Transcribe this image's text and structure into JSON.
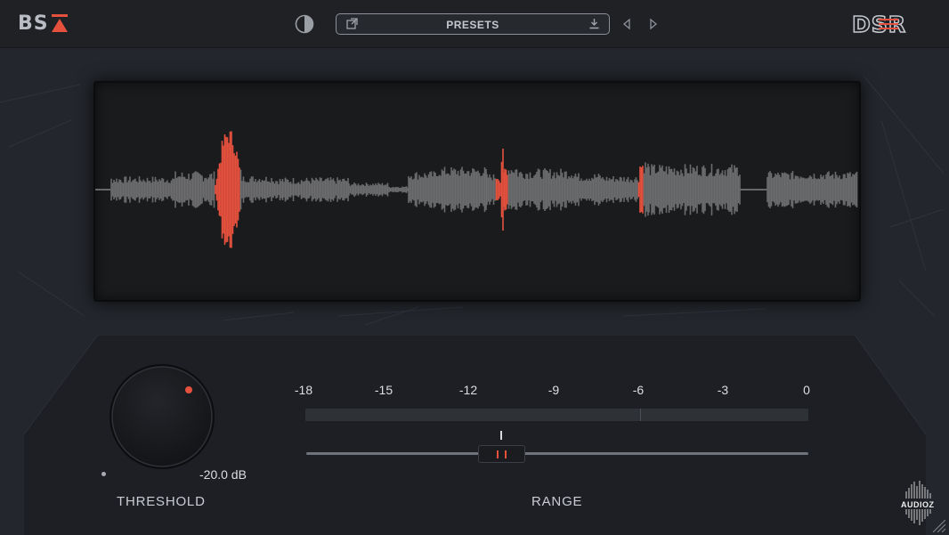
{
  "header": {
    "brand_left": "BS",
    "brand_right": "DSR",
    "presets_label": "PRESETS"
  },
  "icons": {
    "theme": "contrast-half-circle-icon",
    "open": "open-preset-icon",
    "save": "save-preset-icon",
    "prev": "previous-preset-icon",
    "next": "next-preset-icon"
  },
  "colors": {
    "accent": "#e6513e",
    "waveform": "#6b6c6e",
    "background": "#23262c"
  },
  "controls": {
    "threshold": {
      "label": "THRESHOLD",
      "value_text": "-20.0 dB"
    },
    "range": {
      "label": "RANGE",
      "scale": [
        "-18",
        "-15",
        "-12",
        "-9",
        "-6",
        "-3",
        "0"
      ],
      "value_db": -10.7,
      "meter_peak_db": -6
    }
  },
  "watermark": {
    "text": "AUDIOZ"
  }
}
